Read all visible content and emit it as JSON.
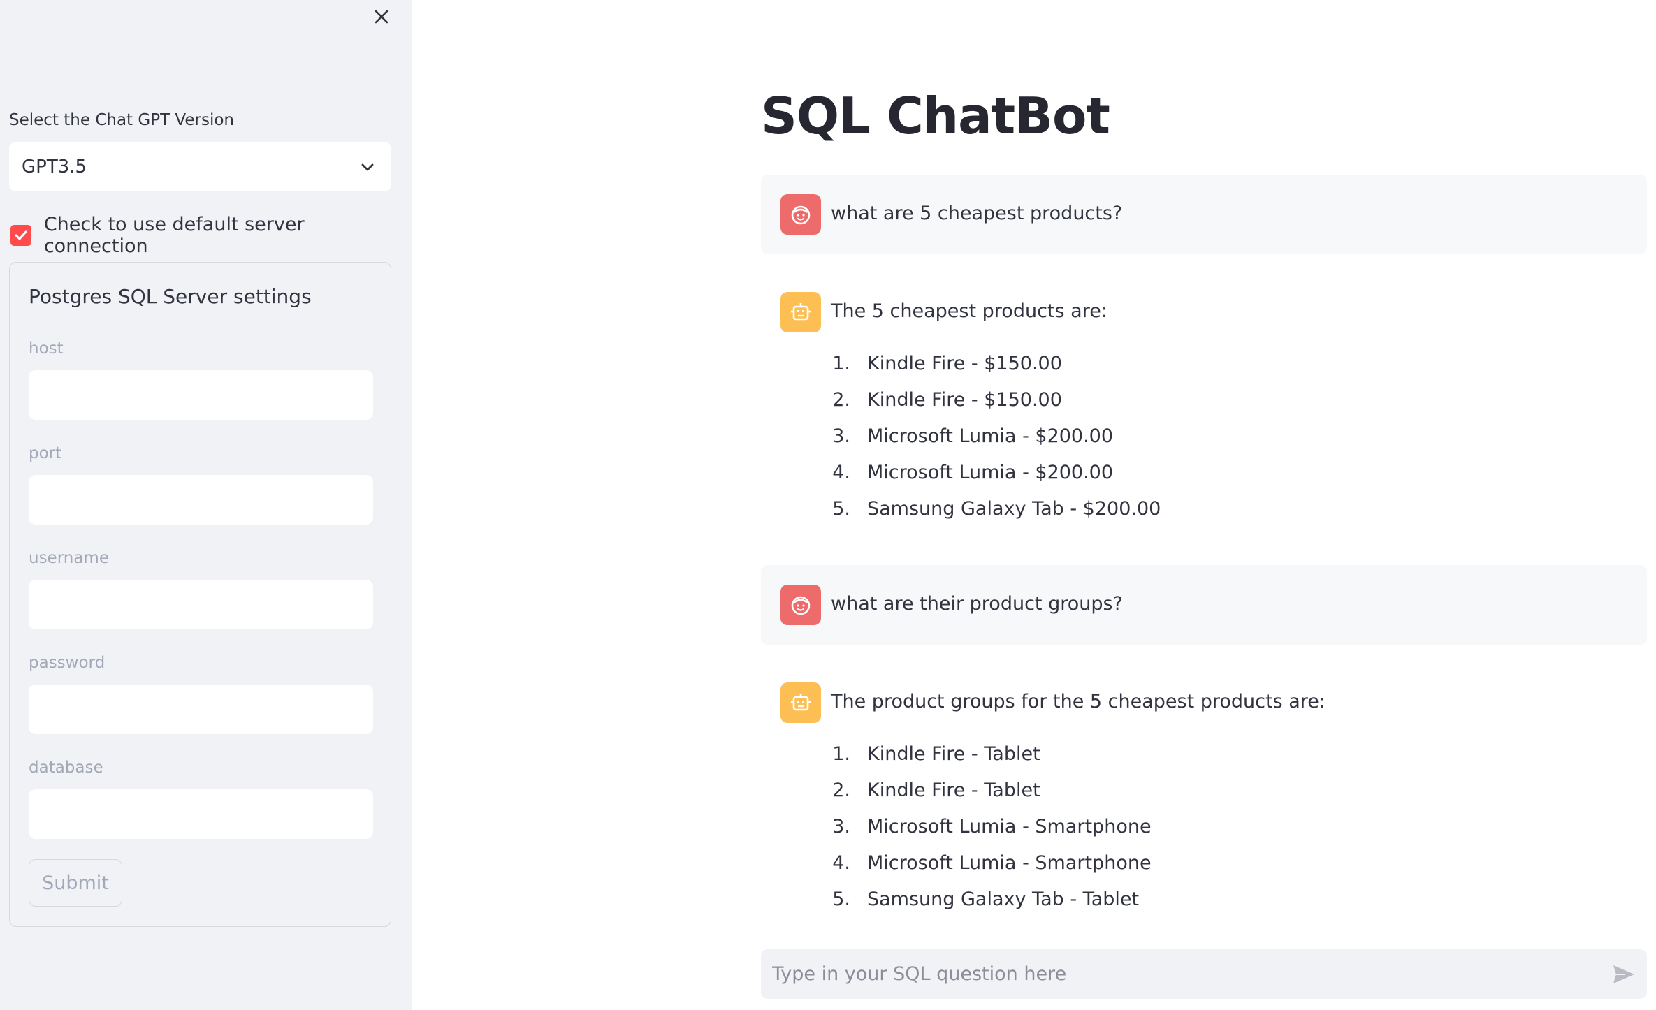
{
  "sidebar": {
    "select_label": "Select the Chat GPT Version",
    "select_value": "GPT3.5",
    "checkbox_label": "Check to use default server connection",
    "checkbox_checked": true,
    "form_title": "Postgres SQL Server settings",
    "fields": [
      {
        "label": "host",
        "value": ""
      },
      {
        "label": "port",
        "value": ""
      },
      {
        "label": "username",
        "value": ""
      },
      {
        "label": "password",
        "value": ""
      },
      {
        "label": "database",
        "value": ""
      }
    ],
    "submit_label": "Submit"
  },
  "main": {
    "title": "SQL ChatBot",
    "messages": [
      {
        "role": "user",
        "text": "what are 5 cheapest products?"
      },
      {
        "role": "assistant",
        "text": "The 5 cheapest products are:",
        "items": [
          {
            "num": "1.",
            "text": "Kindle Fire - $150.00"
          },
          {
            "num": "2.",
            "text": "Kindle Fire - $150.00"
          },
          {
            "num": "3.",
            "text": "Microsoft Lumia - $200.00"
          },
          {
            "num": "4.",
            "text": "Microsoft Lumia - $200.00"
          },
          {
            "num": "5.",
            "text": "Samsung Galaxy Tab - $200.00"
          }
        ]
      },
      {
        "role": "user",
        "text": "what are their product groups?"
      },
      {
        "role": "assistant",
        "text": "The product groups for the 5 cheapest products are:",
        "items": [
          {
            "num": "1.",
            "text": "Kindle Fire - Tablet"
          },
          {
            "num": "2.",
            "text": "Kindle Fire - Tablet"
          },
          {
            "num": "3.",
            "text": "Microsoft Lumia - Smartphone"
          },
          {
            "num": "4.",
            "text": "Microsoft Lumia - Smartphone"
          },
          {
            "num": "5.",
            "text": "Samsung Galaxy Tab - Tablet"
          }
        ]
      }
    ],
    "chat_input_placeholder": "Type in your SQL question here"
  },
  "icons": {
    "close": "close-icon",
    "chevron": "chevron-down-icon",
    "check": "check-icon",
    "user_avatar": "user-face-icon",
    "bot_avatar": "robot-icon",
    "send": "send-icon"
  },
  "colors": {
    "sidebar_bg": "#f0f2f6",
    "accent": "#ff4b4b",
    "user_avatar_bg": "#ee6b6b",
    "bot_avatar_bg": "#fdbe54",
    "user_msg_bg": "#f7f8fa"
  }
}
